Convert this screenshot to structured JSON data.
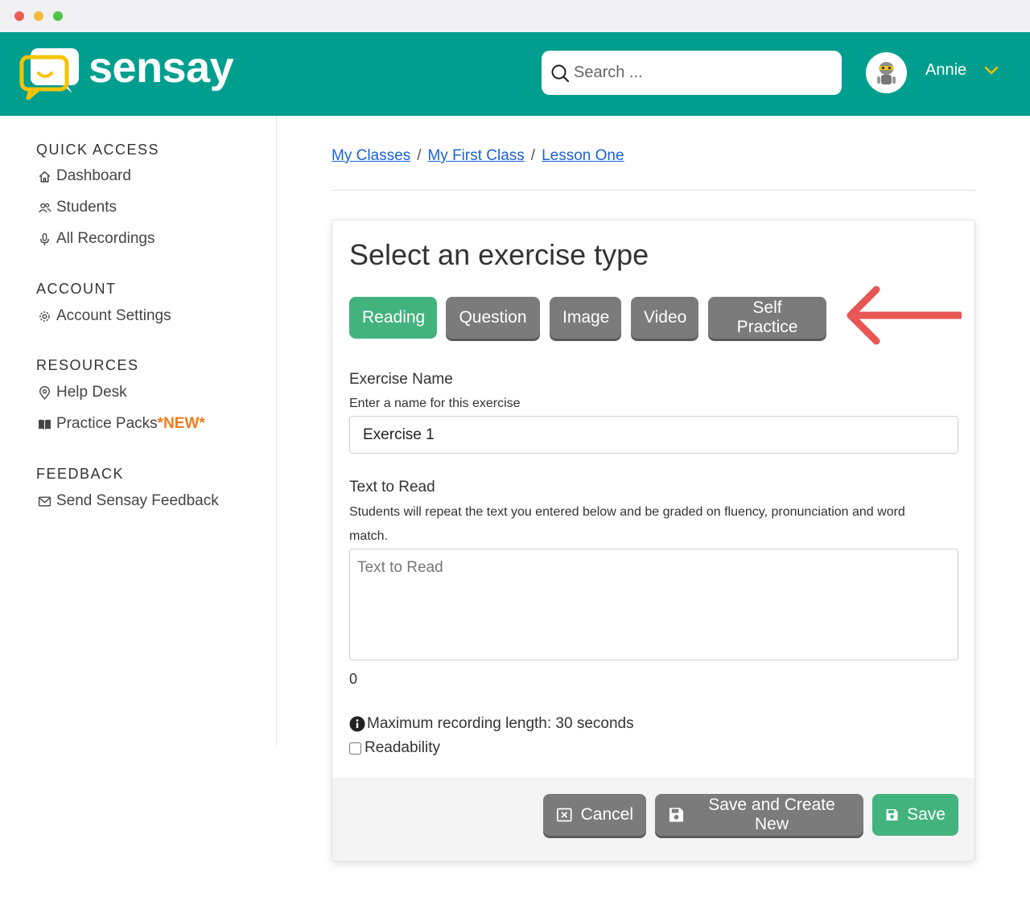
{
  "app": {
    "brand": "sensay",
    "colors": {
      "header": "#009e8e",
      "accent_green": "#43b37d",
      "button_gray": "#7b7b7b",
      "link": "#1a62d6",
      "new_badge": "#f07b1e",
      "arrow": "#e85656"
    }
  },
  "header": {
    "search": {
      "placeholder": "Search ...",
      "icon": "search-icon"
    },
    "user": {
      "name": "Annie",
      "avatar_icon": "robot-avatar",
      "menu_icon": "chevron-down-icon"
    }
  },
  "sidebar": {
    "sections": [
      {
        "heading": "QUICK ACCESS",
        "items": [
          {
            "label": "Dashboard",
            "icon": "home-icon"
          },
          {
            "label": "Students",
            "icon": "users-icon"
          },
          {
            "label": "All Recordings",
            "icon": "microphone-icon"
          }
        ]
      },
      {
        "heading": "ACCOUNT",
        "items": [
          {
            "label": "Account Settings",
            "icon": "gear-icon"
          }
        ]
      },
      {
        "heading": "RESOURCES",
        "items": [
          {
            "label": "Help Desk",
            "icon": "location-pin-icon"
          },
          {
            "label": "Practice Packs",
            "badge": "*NEW*",
            "icon": "book-icon"
          }
        ]
      },
      {
        "heading": "FEEDBACK",
        "items": [
          {
            "label": "Send Sensay Feedback",
            "icon": "envelope-icon"
          }
        ]
      }
    ]
  },
  "breadcrumb": [
    "My Classes",
    "My First Class",
    "Lesson One"
  ],
  "card": {
    "title": "Select an exercise type",
    "exercise_types": [
      {
        "label": "Reading",
        "active": true
      },
      {
        "label": "Question",
        "active": false
      },
      {
        "label": "Image",
        "active": false
      },
      {
        "label": "Video",
        "active": false
      },
      {
        "label": "Self Practice",
        "active": false
      }
    ],
    "exercise_name": {
      "label": "Exercise Name",
      "help": "Enter a name for this exercise",
      "value": "Exercise 1"
    },
    "text_to_read": {
      "label": "Text to Read",
      "help": "Students will repeat the text you entered below and be graded on fluency, pronunciation and word match.",
      "placeholder": "Text to Read",
      "value": "",
      "char_count": "0"
    },
    "max_recording": "Maximum recording length: 30 seconds",
    "readability": {
      "label": "Readability",
      "checked": false
    },
    "footer": {
      "cancel": "Cancel",
      "save_new": "Save and Create New",
      "save": "Save"
    }
  }
}
